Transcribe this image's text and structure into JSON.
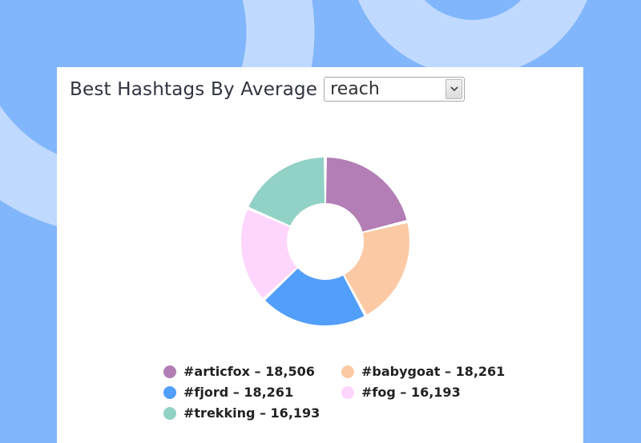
{
  "header": {
    "title": "Best Hashtags By Average",
    "select_value": "reach",
    "select_options": [
      "reach"
    ]
  },
  "chart_data": {
    "type": "pie",
    "donut": true,
    "legend_position": "bottom",
    "slices": [
      {
        "label": "#articfox",
        "value": 18506,
        "display": "#articfox – 18,506",
        "color": "#b27eb5"
      },
      {
        "label": "#babygoat",
        "value": 18261,
        "display": "#babygoat – 18,261",
        "color": "#fbcaa4"
      },
      {
        "label": "#fjord",
        "value": 18261,
        "display": "#fjord – 18,261",
        "color": "#529efb"
      },
      {
        "label": "#fog",
        "value": 16193,
        "display": "#fog – 16,193",
        "color": "#fed5fc"
      },
      {
        "label": "#trekking",
        "value": 16193,
        "display": "#trekking – 16,193",
        "color": "#92d2c6"
      }
    ]
  },
  "colors": {
    "background": "#82b6fc",
    "decoration": "#bfdafe",
    "card": "#ffffff"
  }
}
